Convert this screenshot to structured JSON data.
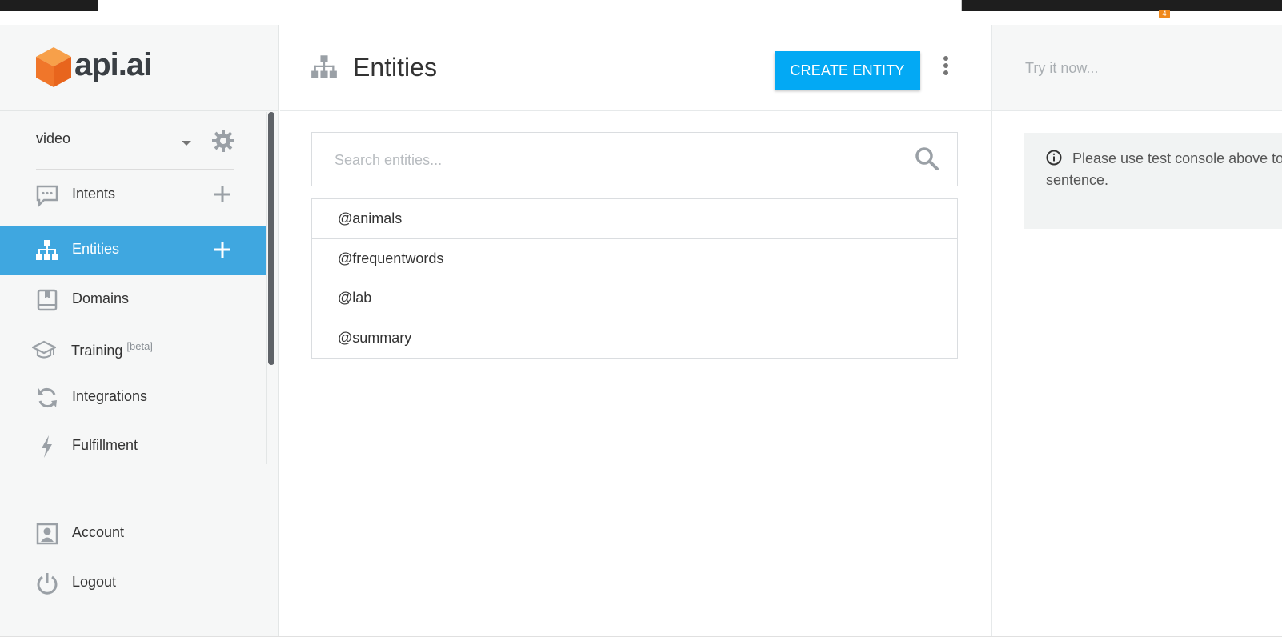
{
  "browser": {
    "notification_count": "4"
  },
  "brand": {
    "logo_text": "api.ai"
  },
  "agent": {
    "name": "video"
  },
  "sidebar": {
    "items": [
      {
        "label": "Intents"
      },
      {
        "label": "Entities"
      },
      {
        "label": "Domains"
      },
      {
        "label": "Training",
        "sup": "[beta]"
      },
      {
        "label": "Integrations"
      },
      {
        "label": "Fulfillment"
      },
      {
        "label": "Account"
      },
      {
        "label": "Logout"
      }
    ]
  },
  "header": {
    "title": "Entities",
    "create_label": "CREATE ENTITY"
  },
  "search": {
    "placeholder": "Search entities..."
  },
  "entities": [
    "@animals",
    "@frequentwords",
    "@lab",
    "@summary"
  ],
  "test_console": {
    "placeholder": "Try it now...",
    "info_text": "Please use test console above to try a sentence."
  },
  "colors": {
    "accent": "#03a9f4",
    "active_nav": "#3fa7e0",
    "logo_orange": "#f0762a",
    "sidebar_bg": "#f6f7f7"
  }
}
